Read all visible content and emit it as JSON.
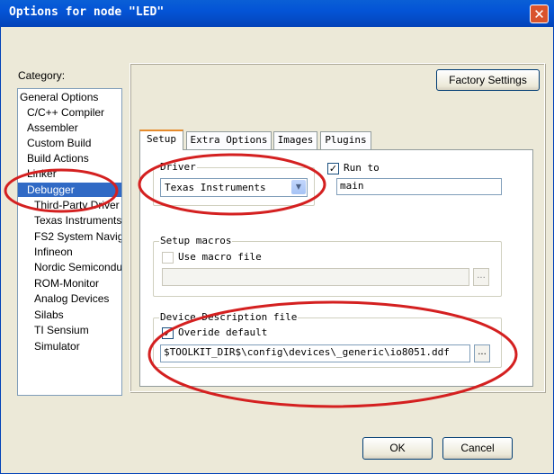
{
  "window": {
    "title": "Options for node \"LED\"",
    "close_glyph": "✕"
  },
  "category": {
    "label": "Category:",
    "items": [
      {
        "label": "General Options",
        "indent": false,
        "selected": false
      },
      {
        "label": "C/C++ Compiler",
        "indent": true,
        "selected": false
      },
      {
        "label": "Assembler",
        "indent": true,
        "selected": false
      },
      {
        "label": "Custom Build",
        "indent": true,
        "selected": false
      },
      {
        "label": "Build Actions",
        "indent": true,
        "selected": false
      },
      {
        "label": "Linker",
        "indent": true,
        "selected": false
      },
      {
        "label": "Debugger",
        "indent": true,
        "selected": true
      },
      {
        "label": "Third-Party Driver",
        "indent": false,
        "selected": false
      },
      {
        "label": "Texas Instruments",
        "indent": false,
        "selected": false
      },
      {
        "label": "FS2 System Navig.",
        "indent": false,
        "selected": false
      },
      {
        "label": "Infineon",
        "indent": false,
        "selected": false
      },
      {
        "label": "Nordic Semiconduc",
        "indent": false,
        "selected": false
      },
      {
        "label": "ROM-Monitor",
        "indent": false,
        "selected": false
      },
      {
        "label": "Analog Devices",
        "indent": false,
        "selected": false
      },
      {
        "label": "Silabs",
        "indent": false,
        "selected": false
      },
      {
        "label": "TI Sensium",
        "indent": false,
        "selected": false
      },
      {
        "label": "Simulator",
        "indent": false,
        "selected": false
      }
    ]
  },
  "factory_settings_label": "Factory Settings",
  "tabs": [
    {
      "label": "Setup",
      "active": true
    },
    {
      "label": "Extra Options",
      "active": false
    },
    {
      "label": "Images",
      "active": false
    },
    {
      "label": "Plugins",
      "active": false
    }
  ],
  "setup": {
    "driver": {
      "label": "Driver",
      "value": "Texas Instruments"
    },
    "run_to": {
      "label": "Run to",
      "checked": true,
      "value": "main"
    },
    "setup_macros": {
      "label": "Setup macros",
      "use_macro_file_label": "Use macro file",
      "checked": false,
      "value": ""
    },
    "device_description": {
      "label": "Device Description file",
      "override_label": "Overide default",
      "checked": true,
      "value": "$TOOLKIT_DIR$\\config\\devices\\_generic\\io8051.ddf"
    },
    "browse_label": "..."
  },
  "buttons": {
    "ok": "OK",
    "cancel": "Cancel"
  },
  "annotation_color": "#d42020"
}
